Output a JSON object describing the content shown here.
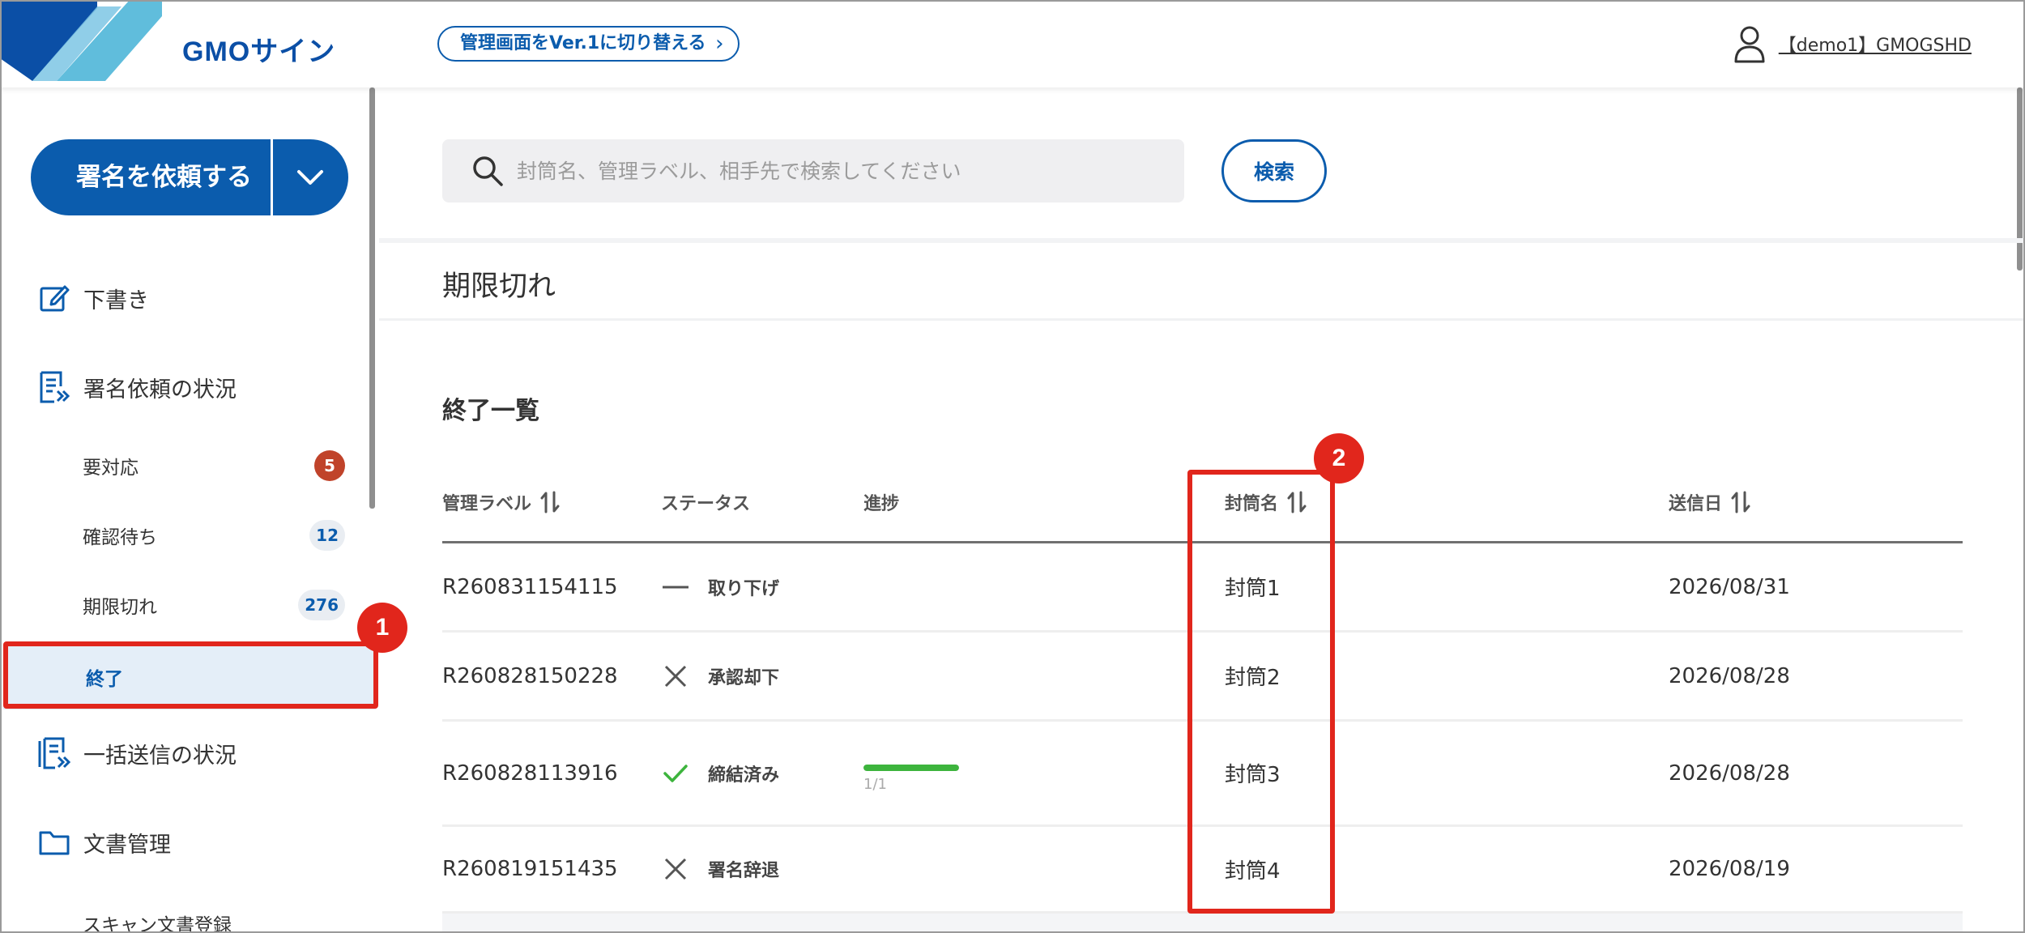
{
  "header": {
    "brand": "GMOサイン",
    "switch_label": "管理画面をVer.1に切り替える",
    "user_name": "【demo1】GMOGSHD",
    "brand_color": "#0b5cad"
  },
  "sidebar": {
    "request_button": "署名を依頼する",
    "items": [
      {
        "label": "下書き",
        "icon": "edit-icon"
      },
      {
        "label": "署名依頼の状況",
        "icon": "document-list-icon"
      },
      {
        "label": "一括送信の状況",
        "icon": "bulk-send-icon"
      },
      {
        "label": "文書管理",
        "icon": "folder-icon"
      }
    ],
    "sub_items": [
      {
        "label": "要対応",
        "badge": "5"
      },
      {
        "label": "確認待ち",
        "badge": "12"
      },
      {
        "label": "期限切れ",
        "badge": "276"
      },
      {
        "label": "終了",
        "badge": ""
      },
      {
        "label": "スキャン文書登録",
        "badge": ""
      }
    ]
  },
  "search": {
    "placeholder": "封筒名、管理ラベル、相手先で検索してください",
    "value": "",
    "button_label": "検索"
  },
  "page": {
    "title": "期限切れ",
    "section_title": "終了一覧"
  },
  "table": {
    "columns": [
      "管理ラベル",
      "ステータス",
      "進捗",
      "封筒名",
      "送信日"
    ],
    "rows": [
      {
        "label": "R260831154115",
        "status": "取り下げ",
        "status_icon": "dash-icon",
        "progress_text": "",
        "progress": null,
        "envelope": "封筒1",
        "date": "2026/08/31"
      },
      {
        "label": "R260828150228",
        "status": "承認却下",
        "status_icon": "x-icon",
        "progress_text": "",
        "progress": null,
        "envelope": "封筒2",
        "date": "2026/08/28"
      },
      {
        "label": "R260828113916",
        "status": "締結済み",
        "status_icon": "check-icon",
        "progress_text": "1/1",
        "progress": 1.0,
        "envelope": "封筒3",
        "date": "2026/08/28"
      },
      {
        "label": "R260819151435",
        "status": "署名辞退",
        "status_icon": "x-icon",
        "progress_text": "",
        "progress": null,
        "envelope": "封筒4",
        "date": "2026/08/19"
      }
    ]
  },
  "annotations": {
    "marker_1": "1",
    "marker_2": "2",
    "color": "#e1261c"
  }
}
